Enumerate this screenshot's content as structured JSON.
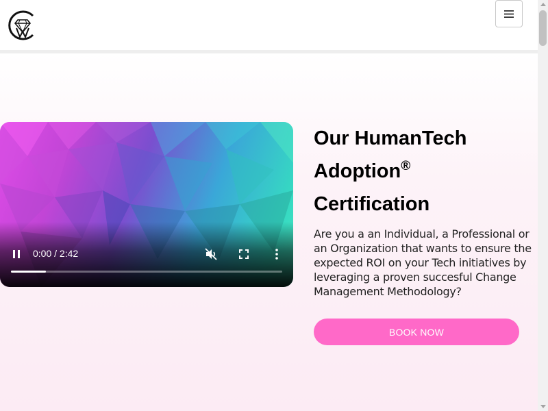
{
  "header": {
    "logo_icon": "diamond-cw-logo-icon",
    "menu_icon": "hamburger-menu-icon"
  },
  "video": {
    "current_time": "0:00",
    "separator": " / ",
    "duration": "2:42",
    "time_text": "0:00 / 2:42",
    "progress_fraction": 0.13,
    "icons": [
      "pause-icon",
      "mute-icon",
      "fullscreen-icon",
      "more-options-icon"
    ]
  },
  "hero": {
    "title_line1": "Our HumanTech",
    "title_line2": "Adoption",
    "title_mark": "®",
    "title_line3": "Certification",
    "description": "Are you a an Individual, a Professional or an Organization  that wants to ensure the expected ROI on your Tech initiatives by leveraging a proven succesful Change Management Methodology?",
    "cta_label": "BOOK NOW"
  },
  "colors": {
    "accent": "#ff69c8",
    "hero_bg": "#fcebf4",
    "header_border": "#eeeeee"
  }
}
